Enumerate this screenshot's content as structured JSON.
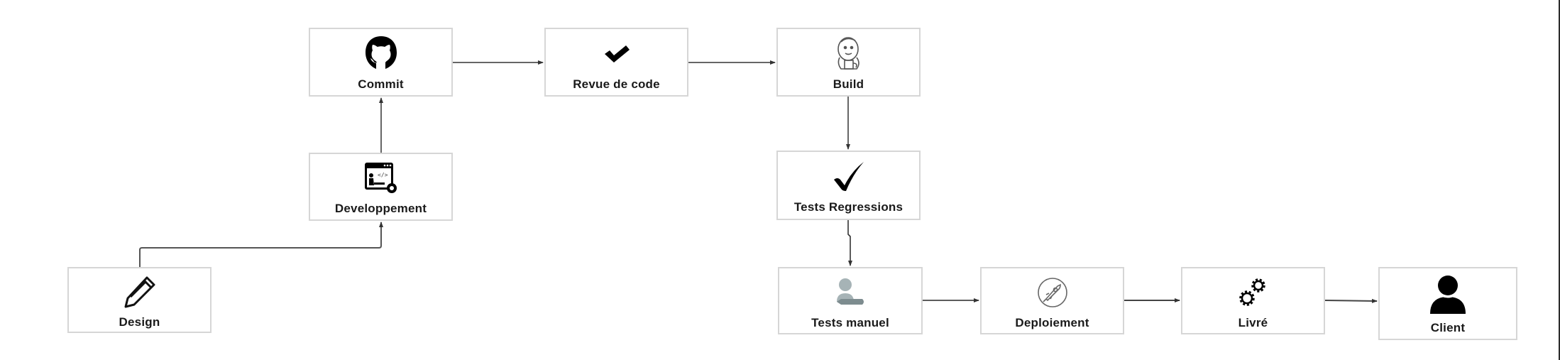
{
  "diagram": {
    "type": "flowchart",
    "theme": {
      "box_border": "#d6d6d6",
      "line": "#333333",
      "text": "#1a1a1a",
      "icon": "#000000",
      "muted_icon": "#9aa8ab"
    },
    "nodes": [
      {
        "id": "design",
        "label": "Design",
        "icon": "pencil-icon"
      },
      {
        "id": "developpement",
        "label": "Developpement",
        "icon": "developer-screen-icon"
      },
      {
        "id": "commit",
        "label": "Commit",
        "icon": "github-icon"
      },
      {
        "id": "revue",
        "label": "Revue de code",
        "icon": "checkmark-icon"
      },
      {
        "id": "build",
        "label": "Build",
        "icon": "jenkins-icon"
      },
      {
        "id": "regressions",
        "label": "Tests Regressions",
        "icon": "checkmark-icon"
      },
      {
        "id": "manuel",
        "label": "Tests manuel",
        "icon": "person-with-pencil-icon"
      },
      {
        "id": "deploiement",
        "label": "Deploiement",
        "icon": "rocket-icon"
      },
      {
        "id": "livre",
        "label": "Livré",
        "icon": "gears-icon"
      },
      {
        "id": "client",
        "label": "Client",
        "icon": "user-icon"
      }
    ],
    "edges": [
      {
        "from": "design",
        "to": "developpement"
      },
      {
        "from": "developpement",
        "to": "commit"
      },
      {
        "from": "commit",
        "to": "revue"
      },
      {
        "from": "revue",
        "to": "build"
      },
      {
        "from": "build",
        "to": "regressions"
      },
      {
        "from": "regressions",
        "to": "manuel"
      },
      {
        "from": "manuel",
        "to": "deploiement"
      },
      {
        "from": "deploiement",
        "to": "livre"
      },
      {
        "from": "livre",
        "to": "client"
      }
    ]
  }
}
